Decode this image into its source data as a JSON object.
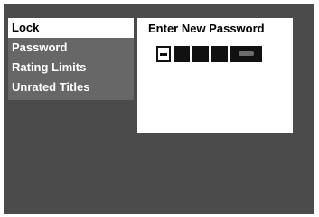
{
  "menu": {
    "items": [
      {
        "label": "Lock",
        "selected": true
      },
      {
        "label": "Password",
        "selected": false
      },
      {
        "label": "Rating Limits",
        "selected": false
      },
      {
        "label": "Unrated Titles",
        "selected": false
      }
    ]
  },
  "dialog": {
    "title": "Enter New Password"
  },
  "colors": {
    "screen_bg": "#4b4b4b",
    "menu_bg": "#676767",
    "selected_bg": "#ffffff",
    "text": "#ffffff",
    "selected_text": "#000000"
  }
}
